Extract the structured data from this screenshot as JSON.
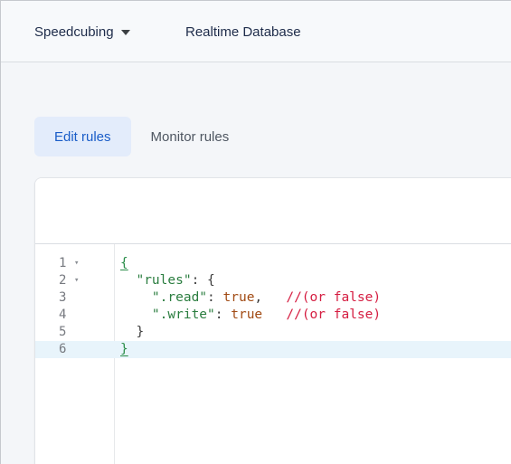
{
  "header": {
    "project_name": "Speedcubing",
    "product_name": "Realtime Database"
  },
  "tabs": [
    {
      "label": "Edit rules",
      "active": true
    },
    {
      "label": "Monitor rules",
      "active": false
    }
  ],
  "editor": {
    "line_numbers": [
      "1",
      "2",
      "3",
      "4",
      "5",
      "6"
    ],
    "folds": {
      "1": "▾",
      "2": "▾"
    },
    "lines": [
      {
        "tokens": [
          {
            "t": "{",
            "c": "brace-hl"
          }
        ]
      },
      {
        "tokens": [
          {
            "t": "  ",
            "c": "punc"
          },
          {
            "t": "\"rules\"",
            "c": "prop"
          },
          {
            "t": ": {",
            "c": "punc"
          }
        ]
      },
      {
        "tokens": [
          {
            "t": "    ",
            "c": "punc"
          },
          {
            "t": "\".read\"",
            "c": "prop"
          },
          {
            "t": ": ",
            "c": "punc"
          },
          {
            "t": "true",
            "c": "bool"
          },
          {
            "t": ",   ",
            "c": "punc"
          },
          {
            "t": "//(or false)",
            "c": "cmt"
          }
        ]
      },
      {
        "tokens": [
          {
            "t": "    ",
            "c": "punc"
          },
          {
            "t": "\".write\"",
            "c": "prop"
          },
          {
            "t": ": ",
            "c": "punc"
          },
          {
            "t": "true",
            "c": "bool"
          },
          {
            "t": "   ",
            "c": "punc"
          },
          {
            "t": "//(or false)",
            "c": "cmt"
          }
        ]
      },
      {
        "tokens": [
          {
            "t": "  }",
            "c": "punc"
          }
        ]
      },
      {
        "tokens": [
          {
            "t": "}",
            "c": "brace-hl"
          }
        ]
      }
    ],
    "active_line": 6
  },
  "colors": {
    "accent": "#1a5dc8",
    "tab_active_bg": "#e3ecfb",
    "property": "#2a7d3f",
    "boolean": "#a14a13",
    "comment": "#d51c40"
  },
  "icons": {
    "project_dropdown": "caret-down-icon",
    "fold": "fold-arrow-icon"
  }
}
